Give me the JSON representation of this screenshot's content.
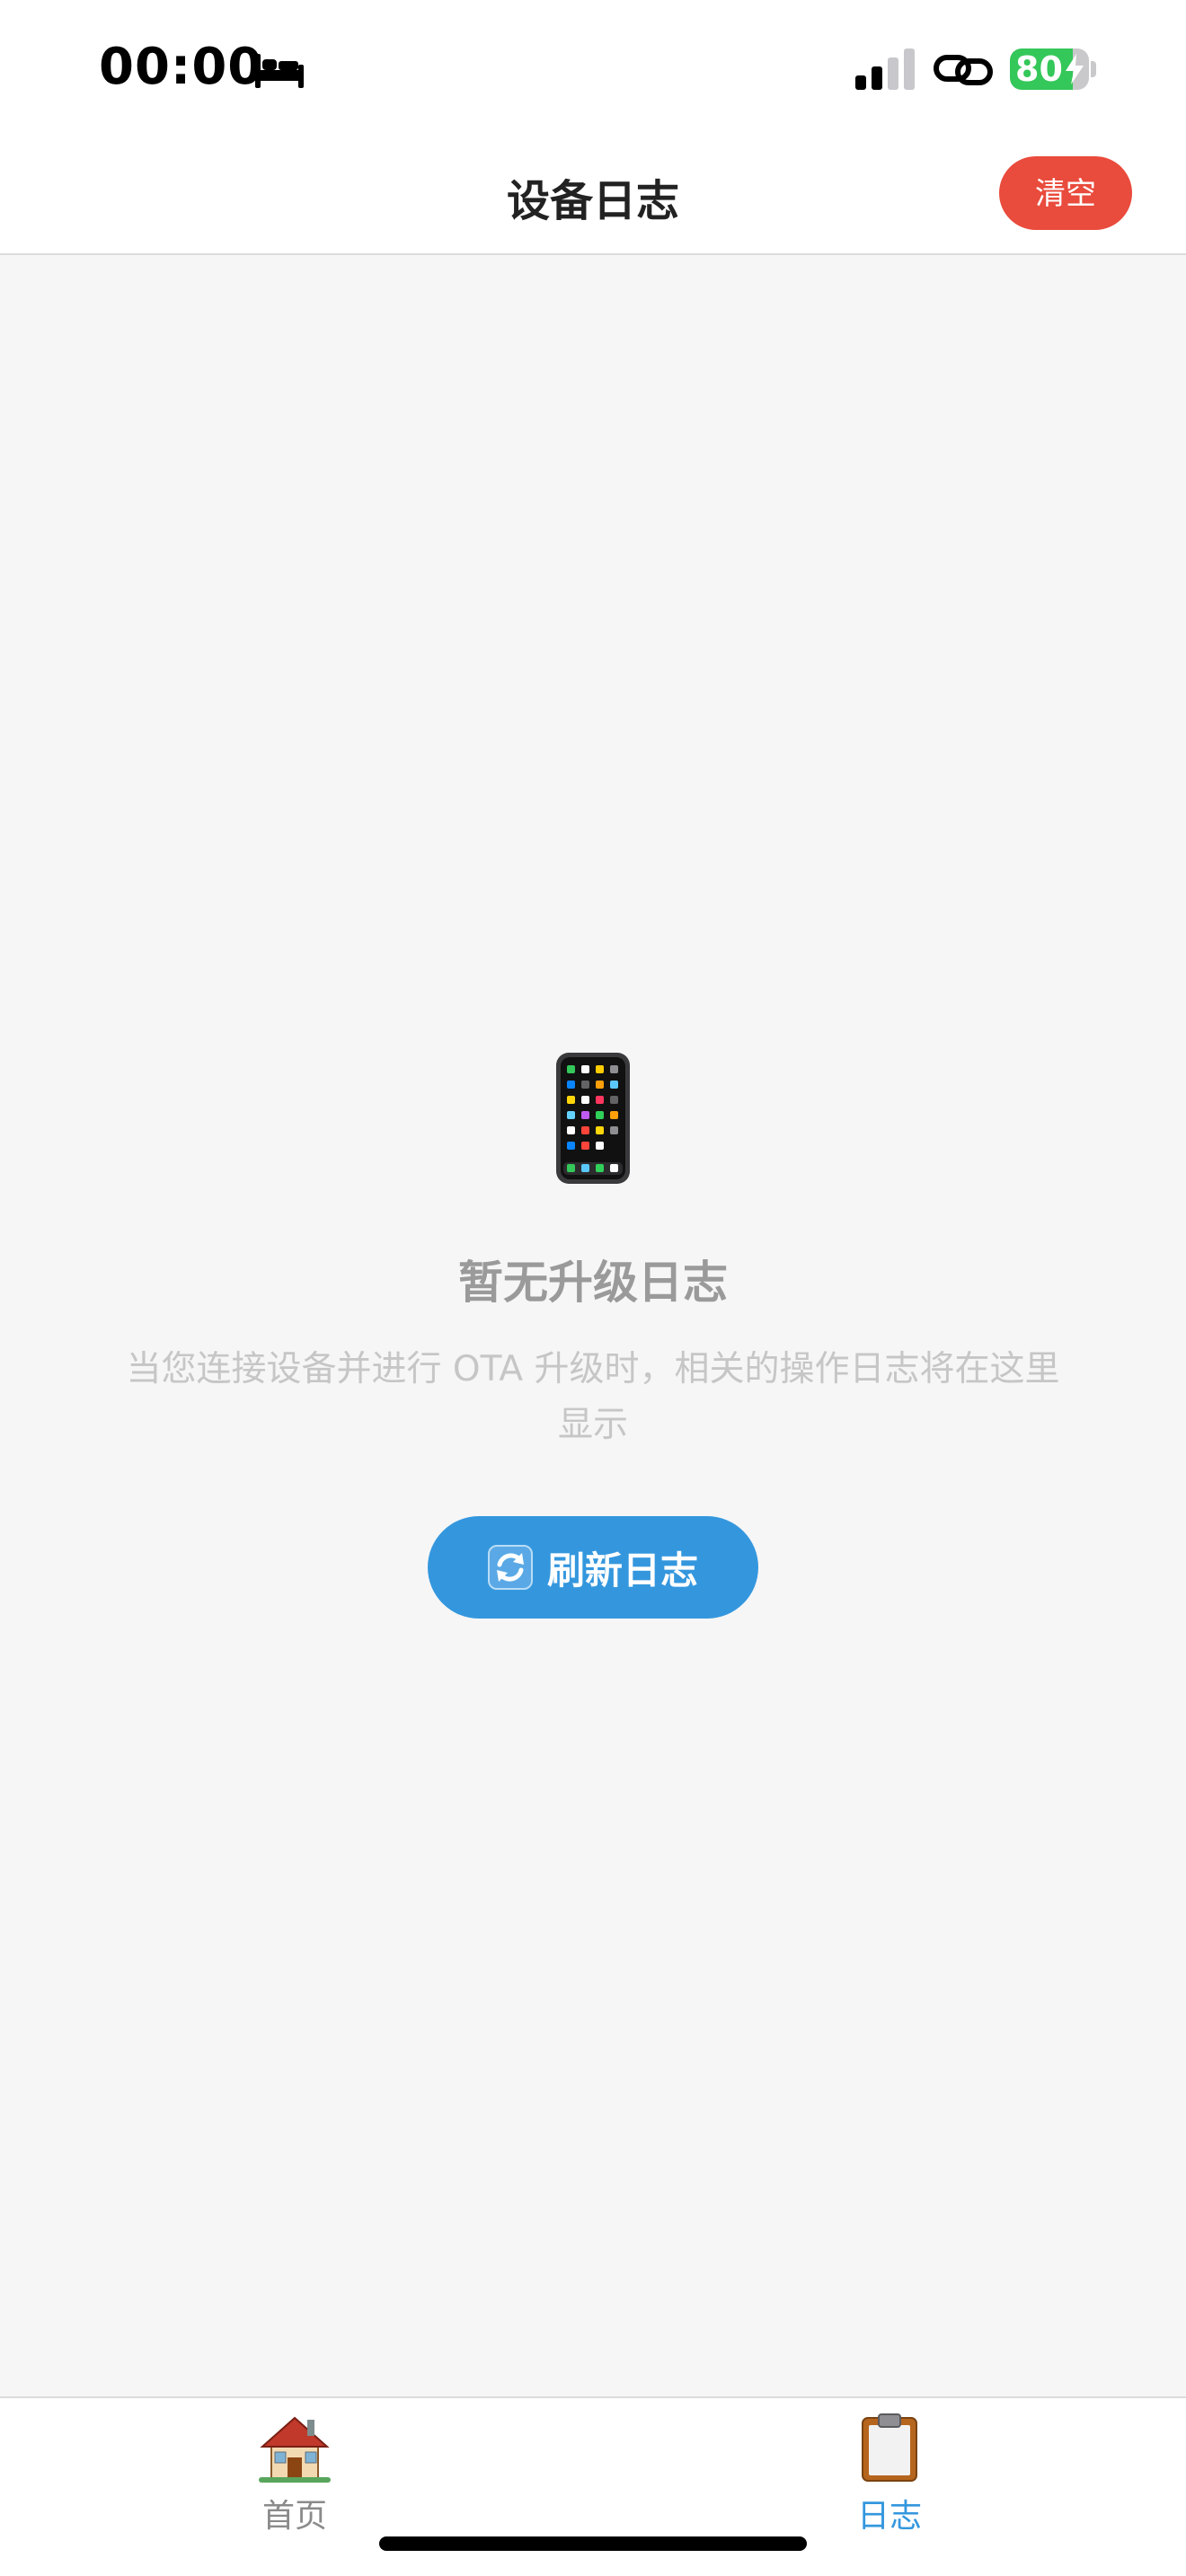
{
  "status_bar": {
    "time": "00:00",
    "battery_percent": 80,
    "battery_text": "80",
    "icons": [
      "bed-icon",
      "signal-icon",
      "link-icon",
      "battery-icon",
      "charging-bolt-icon"
    ],
    "battery_color": "#34c759"
  },
  "header": {
    "title": "设备日志",
    "clear_label": "清空",
    "clear_color": "#e94b3c"
  },
  "empty_state": {
    "icon": "mobile-phone-icon",
    "title": "暂无升级日志",
    "description": "当您连接设备并进行 OTA 升级时，相关的操作日志将在这里显示",
    "refresh_label": "刷新日志",
    "refresh_icon": "refresh-arrows-icon",
    "accent_color": "#3497de"
  },
  "tab_bar": {
    "tabs": [
      {
        "label": "首页",
        "icon": "house-icon",
        "active": false
      },
      {
        "label": "日志",
        "icon": "clipboard-icon",
        "active": true
      }
    ]
  }
}
